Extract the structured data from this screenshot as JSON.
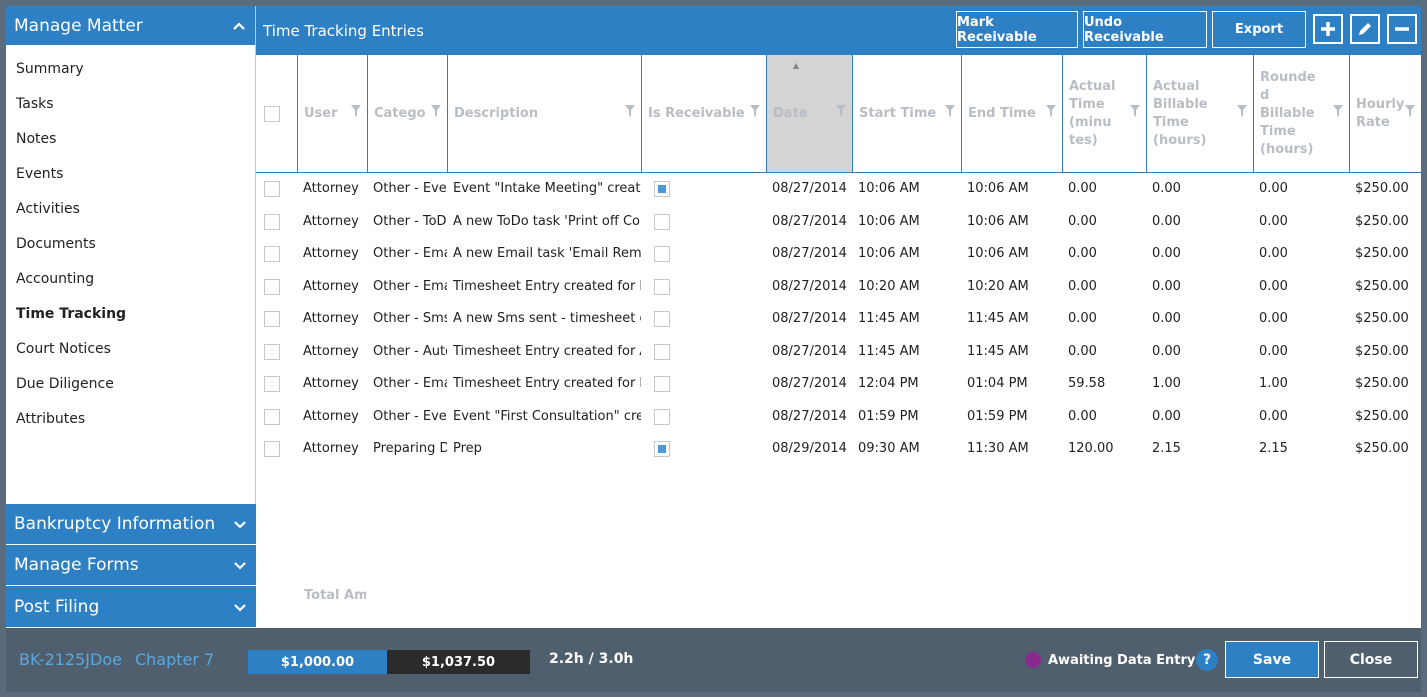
{
  "sidebar": {
    "header": "Manage Matter",
    "items": [
      {
        "label": "Summary"
      },
      {
        "label": "Tasks"
      },
      {
        "label": "Notes"
      },
      {
        "label": "Events"
      },
      {
        "label": "Activities"
      },
      {
        "label": "Documents"
      },
      {
        "label": "Accounting"
      },
      {
        "label": "Time Tracking"
      },
      {
        "label": "Court Notices"
      },
      {
        "label": "Due Diligence"
      },
      {
        "label": "Attributes"
      }
    ],
    "active_label": "Time Tracking",
    "sections": [
      {
        "label": "Bankruptcy Information"
      },
      {
        "label": "Manage Forms"
      },
      {
        "label": "Post Filing"
      }
    ]
  },
  "panel": {
    "title": "Time Tracking Entries",
    "buttons": {
      "mark_receivable": "Mark Receivable",
      "undo_receivable": "Undo Receivable",
      "export": "Export"
    },
    "icons": [
      "add-icon",
      "edit-icon",
      "remove-icon"
    ]
  },
  "grid": {
    "columns": [
      {
        "label": "User"
      },
      {
        "label": "Catego"
      },
      {
        "label": "Description"
      },
      {
        "label": "Is Receivable"
      },
      {
        "label": "Date"
      },
      {
        "label": "Start Time"
      },
      {
        "label": "End Time"
      },
      {
        "label": "Actual\nTime\n(minu\ntes)"
      },
      {
        "label": "Actual\nBillable\nTime\n(hours)"
      },
      {
        "label": "Rounde\nd\nBillable\nTime\n(hours)"
      },
      {
        "label": "Hourly\nRate"
      }
    ],
    "rows": [
      {
        "user": "Attorney",
        "category": "Other - Event",
        "description": "Event \"Intake Meeting\" created",
        "receivable": true,
        "date": "08/27/2014",
        "start": "10:06 AM",
        "end": "10:06 AM",
        "actual_min": "0.00",
        "billable": "0.00",
        "rounded": "0.00",
        "rate": "$250.00"
      },
      {
        "user": "Attorney",
        "category": "Other - ToDo",
        "description": "A new ToDo task 'Print off Co",
        "receivable": false,
        "date": "08/27/2014",
        "start": "10:06 AM",
        "end": "10:06 AM",
        "actual_min": "0.00",
        "billable": "0.00",
        "rounded": "0.00",
        "rate": "$250.00"
      },
      {
        "user": "Attorney",
        "category": "Other - Email",
        "description": "A new Email task 'Email Remin",
        "receivable": false,
        "date": "08/27/2014",
        "start": "10:06 AM",
        "end": "10:06 AM",
        "actual_min": "0.00",
        "billable": "0.00",
        "rounded": "0.00",
        "rate": "$250.00"
      },
      {
        "user": "Attorney",
        "category": "Other - Email",
        "description": "Timesheet Entry created for Em",
        "receivable": false,
        "date": "08/27/2014",
        "start": "10:20 AM",
        "end": "10:20 AM",
        "actual_min": "0.00",
        "billable": "0.00",
        "rounded": "0.00",
        "rate": "$250.00"
      },
      {
        "user": "Attorney",
        "category": "Other - Sms",
        "description": "A new Sms sent - timesheet en",
        "receivable": false,
        "date": "08/27/2014",
        "start": "11:45 AM",
        "end": "11:45 AM",
        "actual_min": "0.00",
        "billable": "0.00",
        "rounded": "0.00",
        "rate": "$250.00"
      },
      {
        "user": "Attorney",
        "category": "Other - Auto",
        "description": "Timesheet Entry created for Au",
        "receivable": false,
        "date": "08/27/2014",
        "start": "11:45 AM",
        "end": "11:45 AM",
        "actual_min": "0.00",
        "billable": "0.00",
        "rounded": "0.00",
        "rate": "$250.00"
      },
      {
        "user": "Attorney",
        "category": "Other - Email",
        "description": "Timesheet Entry created for Em",
        "receivable": false,
        "date": "08/27/2014",
        "start": "12:04 PM",
        "end": "01:04 PM",
        "actual_min": "59.58",
        "billable": "1.00",
        "rounded": "1.00",
        "rate": "$250.00"
      },
      {
        "user": "Attorney",
        "category": "Other - Event",
        "description": "Event \"First Consultation\" crea",
        "receivable": false,
        "date": "08/27/2014",
        "start": "01:59 PM",
        "end": "01:59 PM",
        "actual_min": "0.00",
        "billable": "0.00",
        "rounded": "0.00",
        "rate": "$250.00"
      },
      {
        "user": "Attorney",
        "category": "Preparing Documents",
        "description": "Prep",
        "receivable": true,
        "date": "08/29/2014",
        "start": "09:30 AM",
        "end": "11:30 AM",
        "actual_min": "120.00",
        "billable": "2.15",
        "rounded": "2.15",
        "rate": "$250.00"
      }
    ],
    "total_label": "Total Amount"
  },
  "footer": {
    "case_id": "BK-2125JDoe",
    "chapter": "Chapter 7",
    "amount_1": "$1,000.00",
    "amount_2": "$1,037.50",
    "hours": "2.2h / 3.0h",
    "status": "Awaiting Data Entry",
    "status_color": "#8b2a8e",
    "help": "?",
    "save": "Save",
    "close": "Close"
  }
}
